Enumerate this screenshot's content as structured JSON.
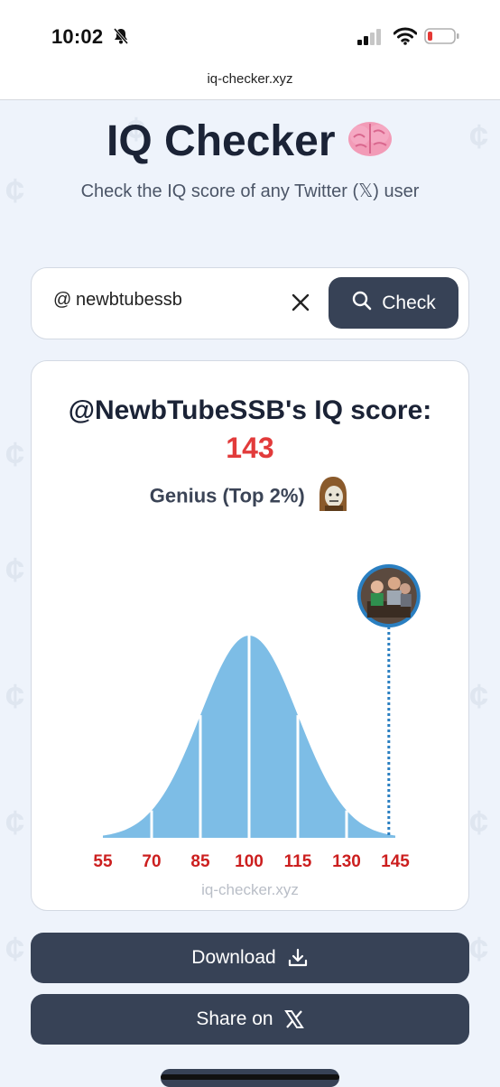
{
  "status_bar": {
    "time": "10:02"
  },
  "browser": {
    "url": "iq-checker.xyz"
  },
  "header": {
    "title": "IQ Checker",
    "subtitle": "Check the IQ score of any Twitter (𝕏) user"
  },
  "search": {
    "prefix": "@",
    "value": "newbtubessb",
    "check_label": "Check"
  },
  "result": {
    "heading": "@NewbTubeSSB's IQ score:",
    "score": "143",
    "category": "Genius (Top 2%)",
    "watermark": "iq-checker.xyz"
  },
  "chart_data": {
    "type": "area",
    "title": "",
    "xlabel": "",
    "ylabel": "",
    "x_ticks": [
      "55",
      "70",
      "85",
      "100",
      "115",
      "130",
      "145"
    ],
    "xlim": [
      55,
      145
    ],
    "distribution": {
      "mean": 100,
      "sd": 15
    },
    "marker_value": 143,
    "fill_color": "#7dbde6",
    "tick_color": "#cc1f1f",
    "marker_color": "#2a7fc1"
  },
  "actions": {
    "download_label": "Download",
    "share_label": "Share on"
  }
}
